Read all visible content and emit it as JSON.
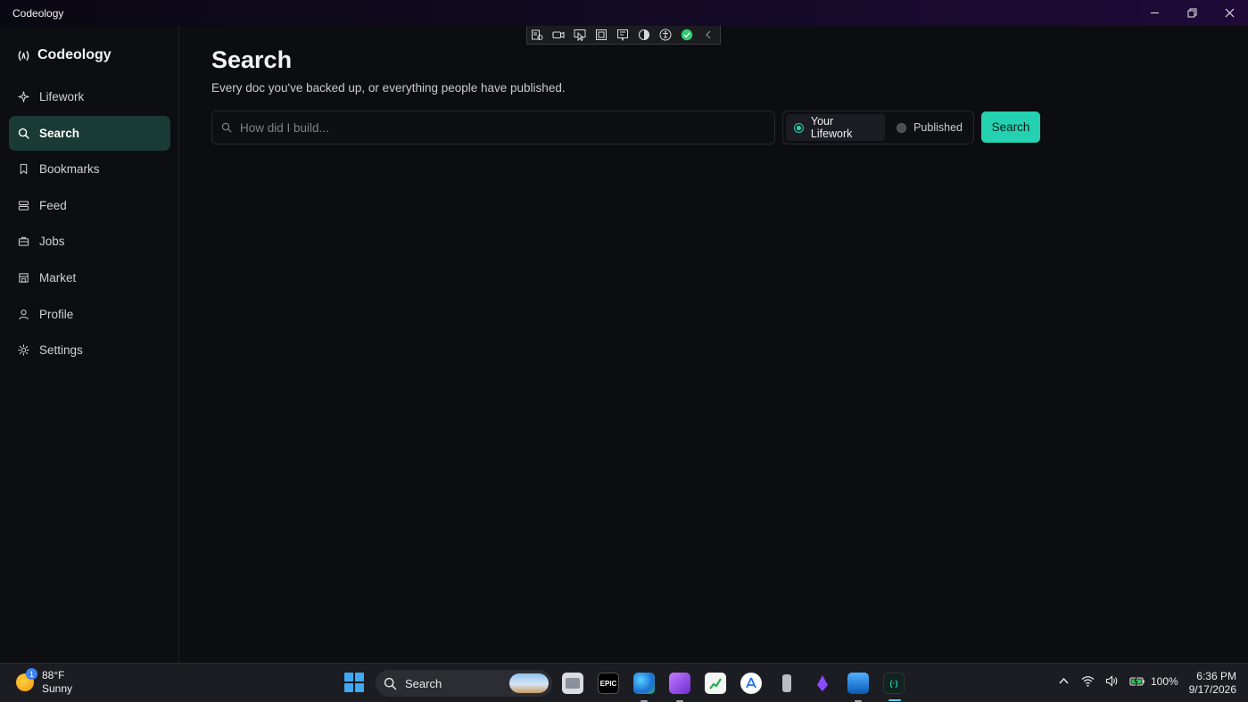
{
  "window": {
    "title": "Codeology",
    "controls": {
      "minimize": "minimize-icon",
      "restore": "restore-icon",
      "close": "close-icon"
    }
  },
  "sidebar": {
    "brand": "Codeology",
    "items": [
      {
        "label": "Lifework",
        "icon": "sparkle-icon",
        "active": false
      },
      {
        "label": "Search",
        "icon": "search-icon",
        "active": true
      },
      {
        "label": "Bookmarks",
        "icon": "bookmark-icon",
        "active": false
      },
      {
        "label": "Feed",
        "icon": "feed-icon",
        "active": false
      },
      {
        "label": "Jobs",
        "icon": "briefcase-icon",
        "active": false
      },
      {
        "label": "Market",
        "icon": "store-icon",
        "active": false
      },
      {
        "label": "Profile",
        "icon": "user-icon",
        "active": false
      },
      {
        "label": "Settings",
        "icon": "settings-icon",
        "active": false
      }
    ]
  },
  "main": {
    "title": "Search",
    "subtitle": "Every doc you've backed up, or everything people have published.",
    "search": {
      "placeholder": "How did I build...",
      "value": ""
    },
    "scope": {
      "options": [
        {
          "label": "Your Lifework",
          "selected": true
        },
        {
          "label": "Published",
          "selected": false
        }
      ]
    },
    "search_button": "Search"
  },
  "taskbar": {
    "weather": {
      "temp": "88°F",
      "condition": "Sunny",
      "badge": "1"
    },
    "search_label": "Search",
    "tray": {
      "battery": "100%"
    },
    "clock": {
      "time": "6:36 PM",
      "date": "9/17/2026"
    }
  },
  "colors": {
    "accent": "#24d1b0",
    "active_nav_bg": "#1a3a35",
    "background": "#0c0d10"
  }
}
